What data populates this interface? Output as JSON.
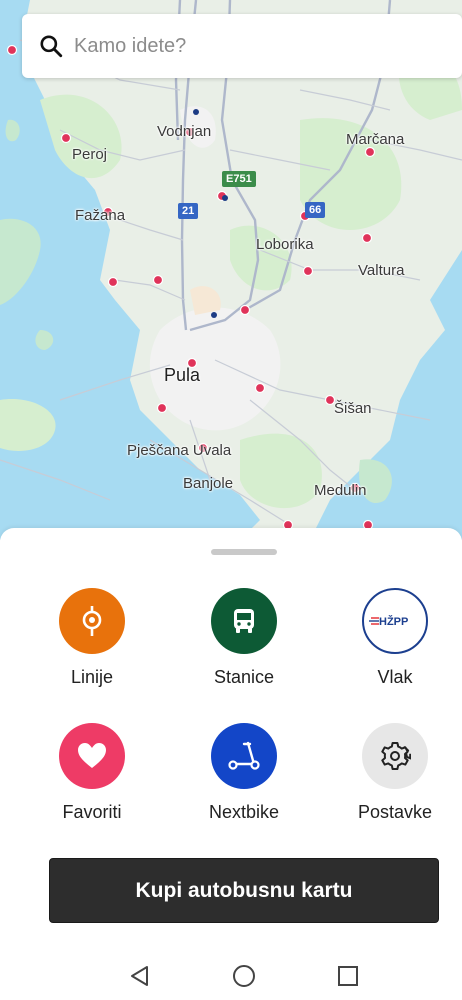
{
  "search": {
    "placeholder": "Kamo idete?"
  },
  "map": {
    "places": {
      "vodnjan": "Vodnjan",
      "peroj": "Peroj",
      "fazana": "Fažana",
      "marcana": "Marčana",
      "loborika": "Loborika",
      "valtura": "Valtura",
      "pula": "Pula",
      "sisan": "Šišan",
      "pjescana_uvala": "Pješčana Uvala",
      "banjole": "Banjole",
      "medulin": "Medulin"
    },
    "shields": {
      "e751": "E751",
      "r21": "21",
      "r66": "66"
    },
    "colors": {
      "water": "#a7dbf2",
      "land": "#e9efe7",
      "green": "#c6e8cf",
      "urban": "#f0f0f0",
      "road": "#aab3c7",
      "stop": "#e0335a"
    }
  },
  "menu": {
    "linije": {
      "label": "Linije",
      "icon": "route-pin-icon",
      "color": "#e8720c"
    },
    "stanice": {
      "label": "Stanice",
      "icon": "bus-icon",
      "color": "#0d5a35"
    },
    "vlak": {
      "label": "Vlak",
      "icon": "hzpp-logo-icon",
      "logo_text": "HŽPP",
      "color": "#ffffff"
    },
    "favoriti": {
      "label": "Favoriti",
      "icon": "heart-icon",
      "color": "#ee3b66"
    },
    "nextbike": {
      "label": "Nextbike",
      "icon": "scooter-icon",
      "color": "#1346c8"
    },
    "postavke": {
      "label": "Postavke",
      "icon": "gear-icon",
      "color": "#e7e7e7"
    }
  },
  "buy_ticket": {
    "label": "Kupi autobusnu kartu"
  },
  "navbar": {
    "back": "back-icon",
    "home": "home-icon",
    "recents": "recents-icon"
  }
}
